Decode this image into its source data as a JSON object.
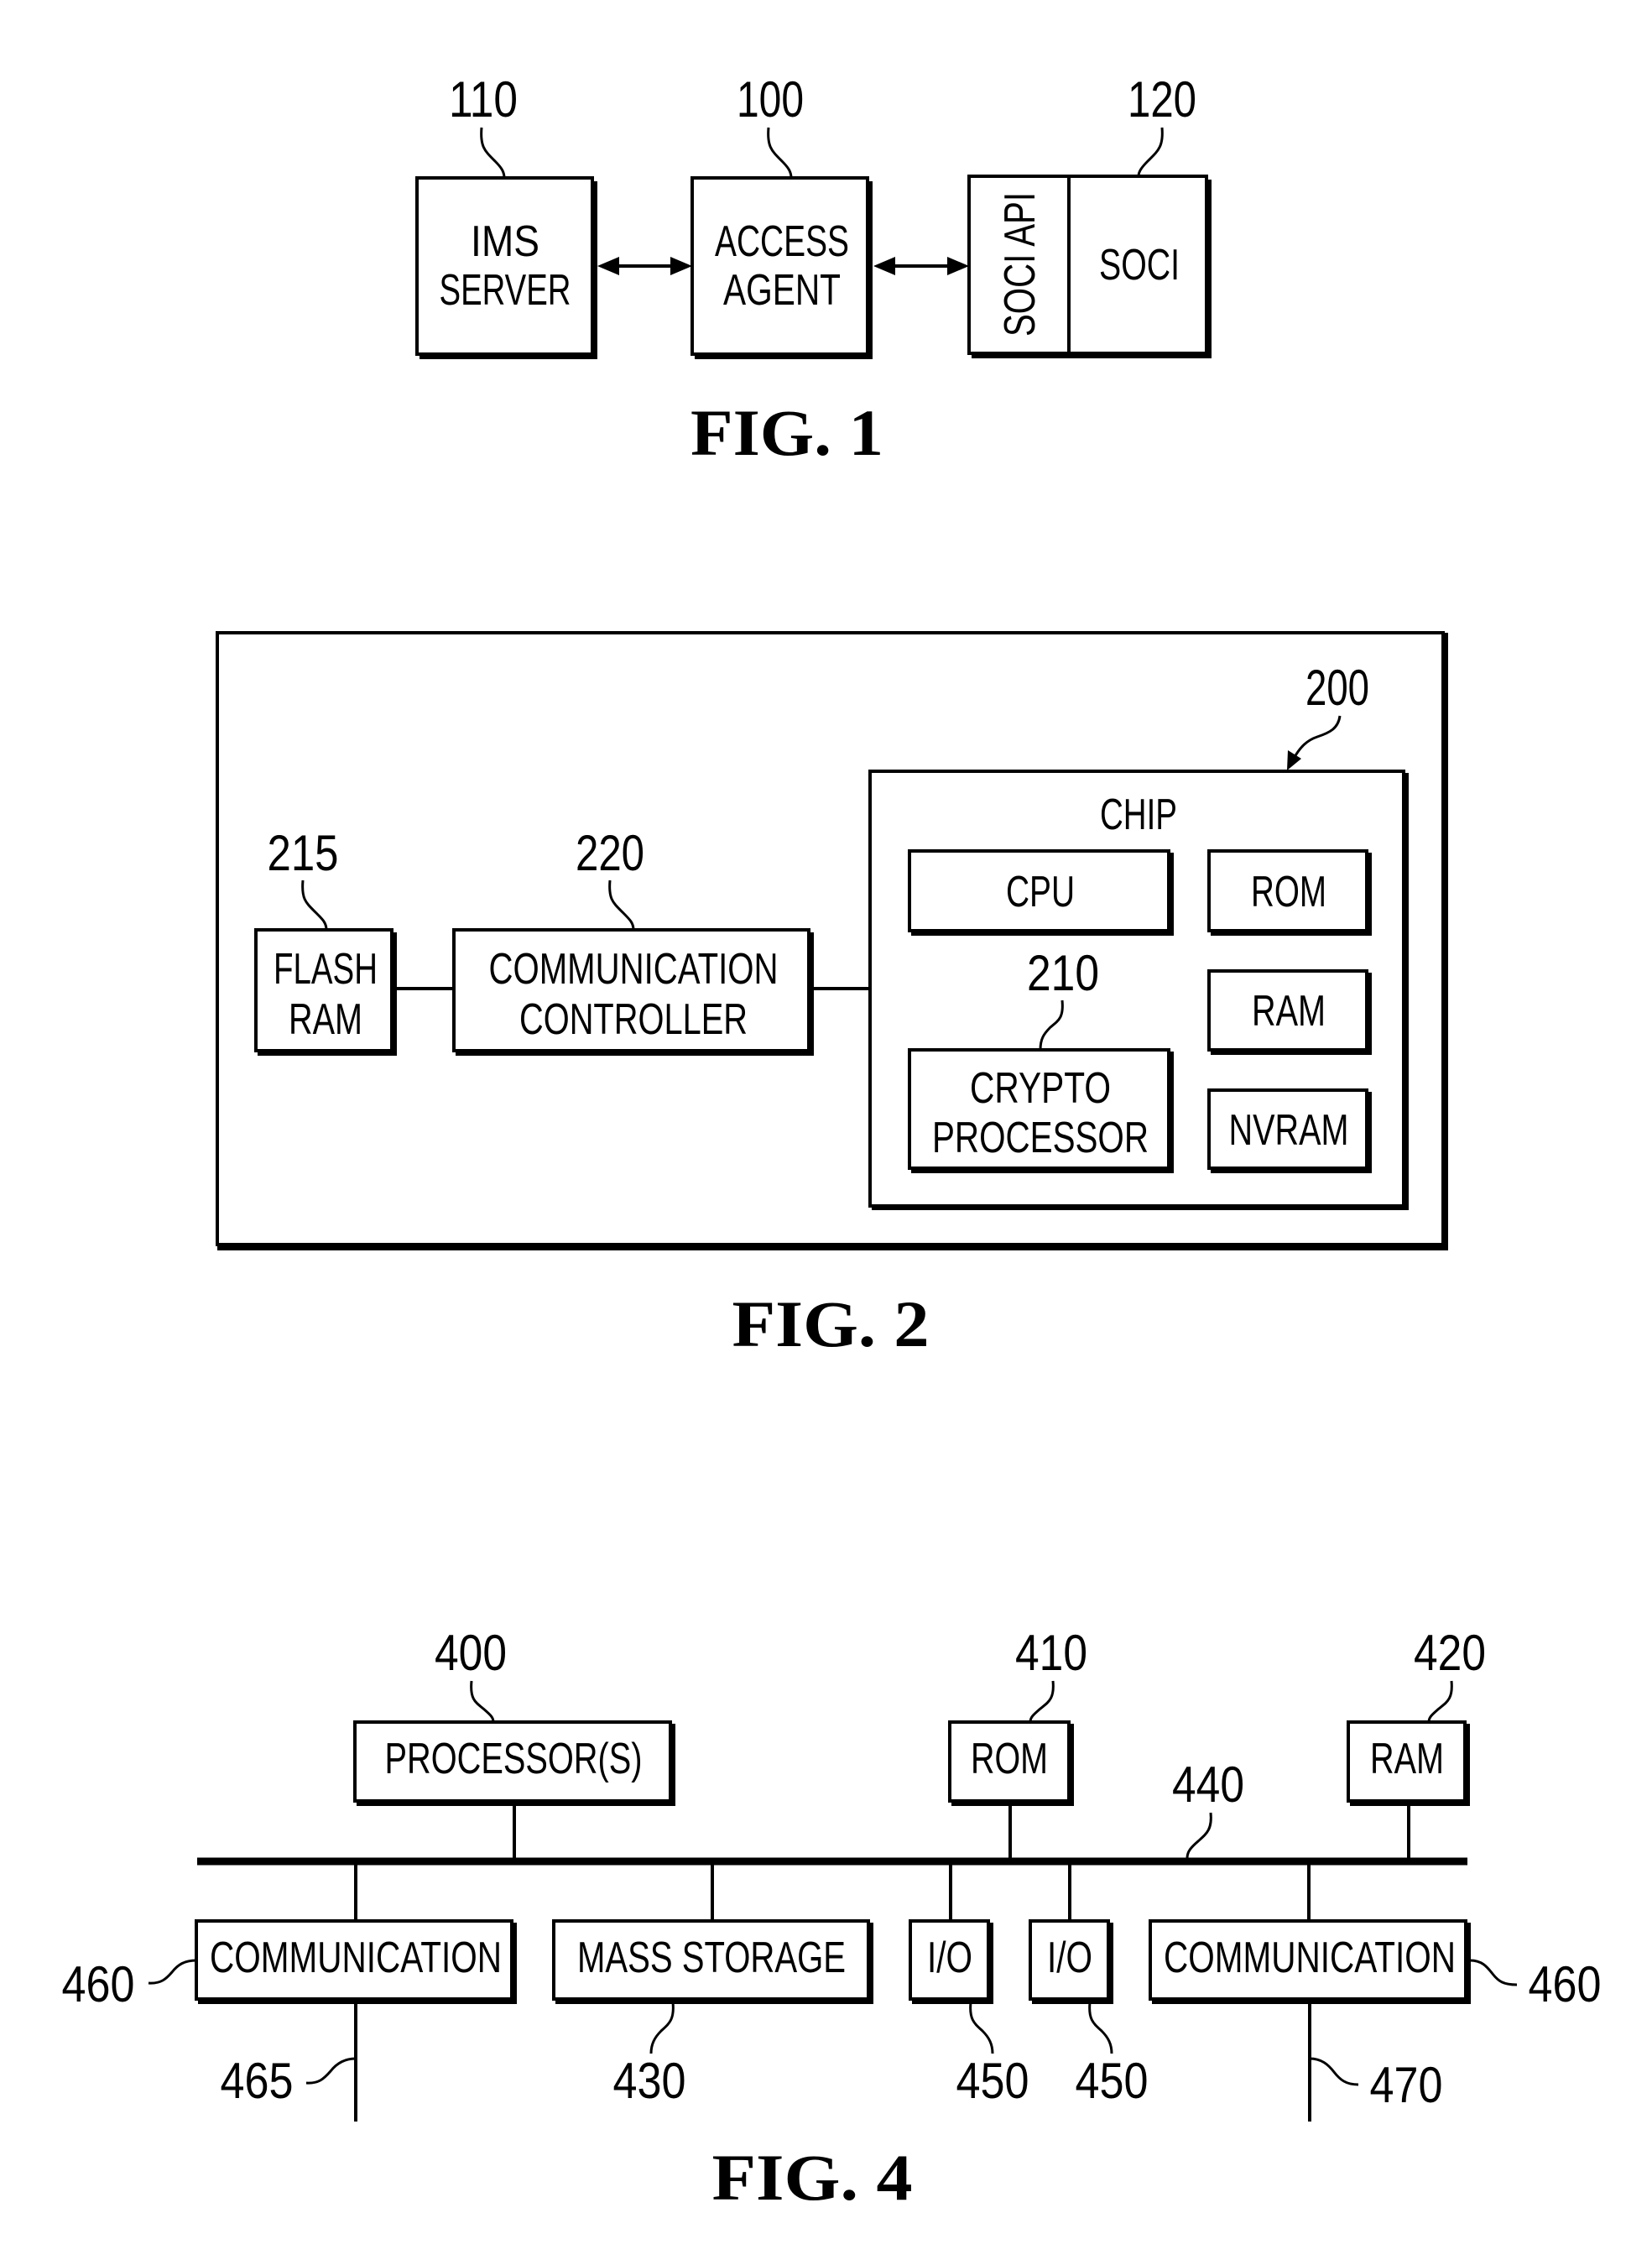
{
  "fig1": {
    "caption": "FIG. 1",
    "ims_server": {
      "ref": "110",
      "line1": "IMS",
      "line2": "SERVER"
    },
    "access_agent": {
      "ref": "100",
      "line1": "ACCESS",
      "line2": "AGENT"
    },
    "soci": {
      "ref": "120",
      "api_label": "SOCI API",
      "label": "SOCI"
    }
  },
  "fig2": {
    "caption": "FIG. 2",
    "flash_ram": {
      "ref": "215",
      "line1": "FLASH",
      "line2": "RAM"
    },
    "comm_controller": {
      "ref": "220",
      "line1": "COMMUNICATION",
      "line2": "CONTROLLER"
    },
    "chip": {
      "ref": "200",
      "label": "CHIP",
      "cpu": "CPU",
      "rom": "ROM",
      "ram": "RAM",
      "nvram": "NVRAM",
      "crypto": {
        "ref": "210",
        "line1": "CRYPTO",
        "line2": "PROCESSOR"
      }
    }
  },
  "fig4": {
    "caption": "FIG. 4",
    "processor": {
      "ref": "400",
      "label": "PROCESSOR(S)"
    },
    "rom": {
      "ref": "410",
      "label": "ROM"
    },
    "ram": {
      "ref": "420",
      "label": "RAM"
    },
    "bus": {
      "ref": "440"
    },
    "comm_left": {
      "ref": "460",
      "label": "COMMUNICATION",
      "link_ref": "465"
    },
    "mass_storage": {
      "ref": "430",
      "label": "MASS STORAGE"
    },
    "io_1": {
      "ref": "450",
      "label": "I/O"
    },
    "io_2": {
      "ref": "450",
      "label": "I/O"
    },
    "comm_right": {
      "ref": "460",
      "label": "COMMUNICATION",
      "link_ref": "470"
    }
  }
}
